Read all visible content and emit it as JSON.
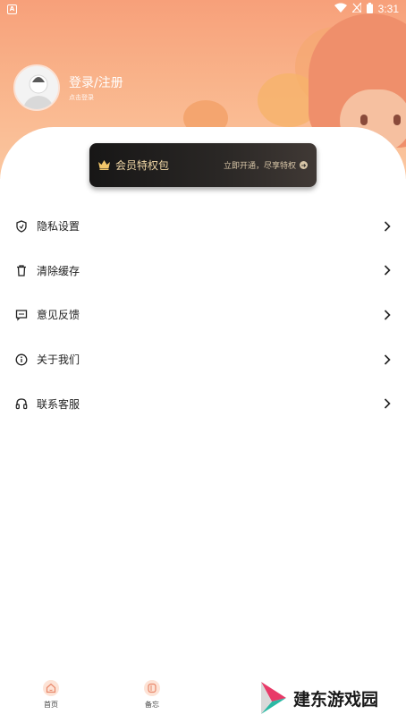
{
  "status_bar": {
    "time": "3:31",
    "notification_icon": "a-icon",
    "wifi_icon": "wifi-icon",
    "signal_icon": "no-signal-icon",
    "battery_icon": "battery-icon"
  },
  "profile": {
    "login_label": "登录/注册",
    "login_hint": "点击登录"
  },
  "vip_banner": {
    "title": "会员特权包",
    "cta": "立即开通，尽享特权"
  },
  "menu": {
    "items": [
      {
        "label": "隐私设置",
        "icon": "shield-icon"
      },
      {
        "label": "清除缓存",
        "icon": "trash-icon"
      },
      {
        "label": "意见反馈",
        "icon": "message-icon"
      },
      {
        "label": "关于我们",
        "icon": "info-icon"
      },
      {
        "label": "联系客服",
        "icon": "headset-icon"
      }
    ]
  },
  "bottom_nav": {
    "items": [
      {
        "label": "首页",
        "icon": "home-icon"
      },
      {
        "label": "备忘",
        "icon": "memo-icon"
      }
    ]
  },
  "watermark": {
    "text": "建东游戏园"
  },
  "colors": {
    "header_top": "#f7a07a",
    "header_bottom": "#fbc7a0",
    "vip_bg": "#1f1d1c",
    "vip_gold": "#f3d9a8"
  }
}
